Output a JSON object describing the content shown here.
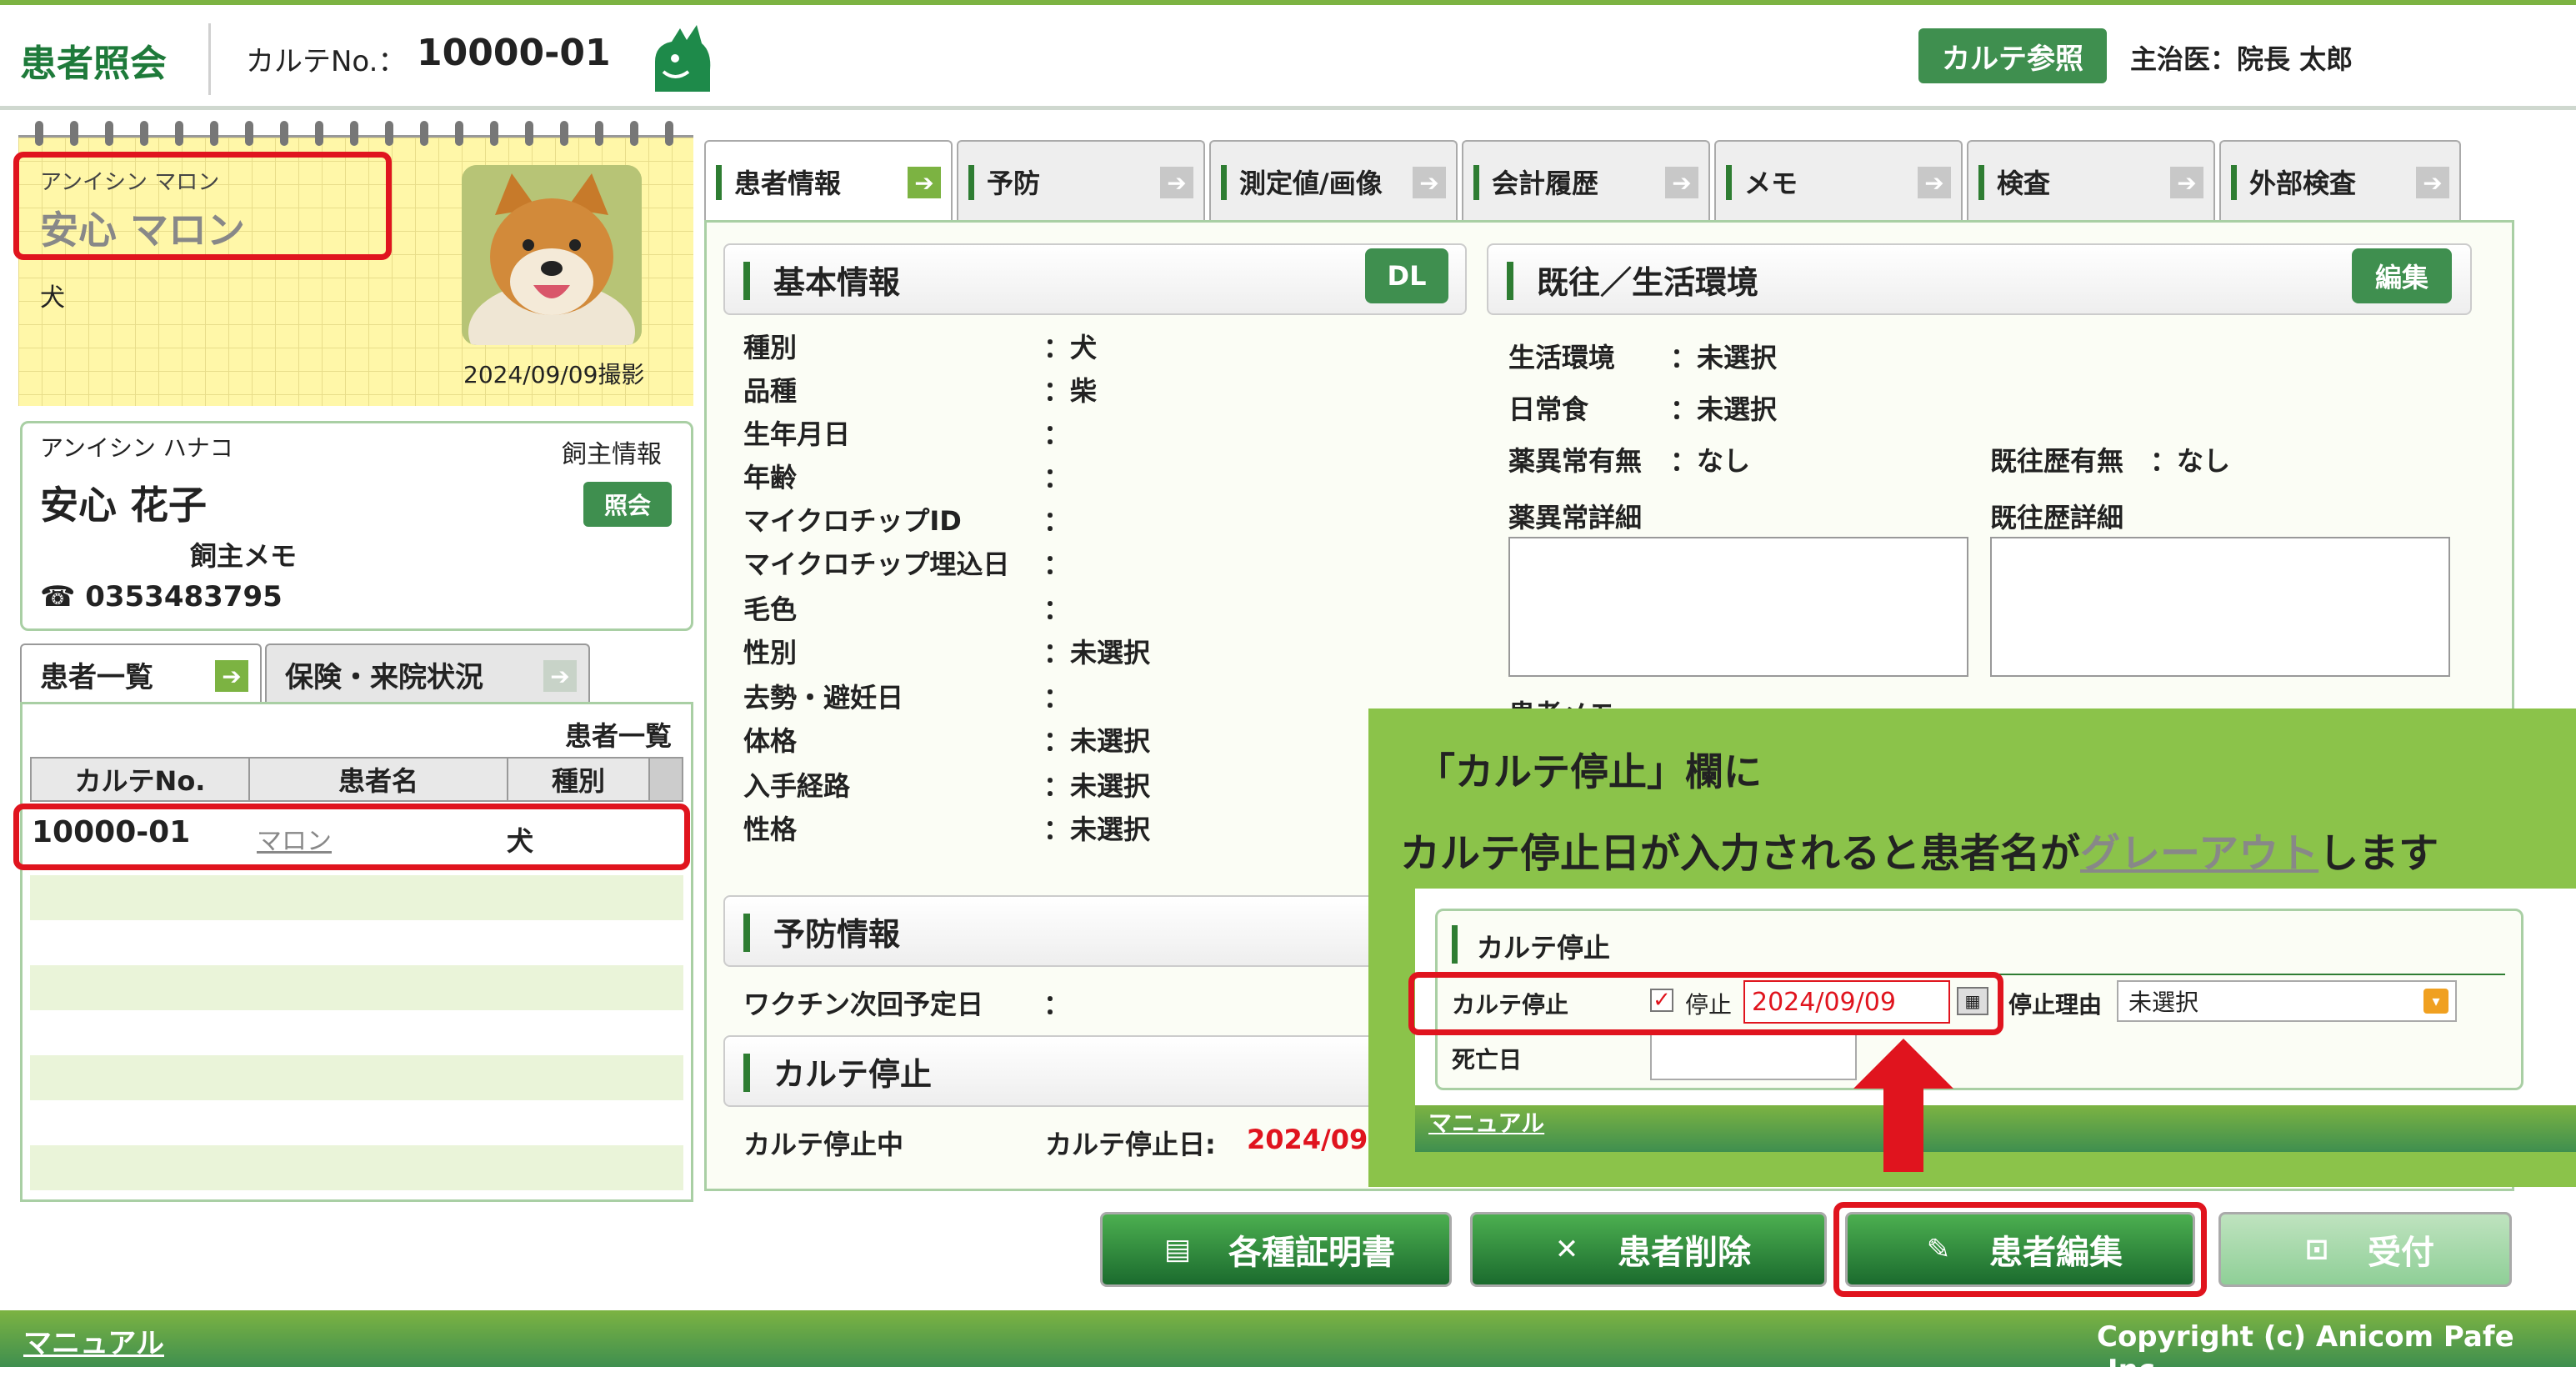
{
  "header": {
    "title": "患者照会",
    "karte_label": "カルテNo.：",
    "karte_no": "10000-01",
    "ref_button": "カルテ参照",
    "doctor": "主治医：院長 太郎"
  },
  "patient": {
    "kana": "アンイシン マロン",
    "name": "安心 マロン",
    "species": "犬",
    "photo_date": "2024/09/09撮影"
  },
  "owner": {
    "kana": "アンイシン ハナコ",
    "label": "飼主情報",
    "name": "安心 花子",
    "ref_button": "照会",
    "memo": "飼主メモ",
    "phone": "0353483795"
  },
  "left_tabs": [
    {
      "label": "患者一覧",
      "arrow": "➔"
    },
    {
      "label": "保険・来院状況",
      "arrow": "➔"
    }
  ],
  "patient_list": {
    "title": "患者一覧",
    "columns": [
      "カルテNo.",
      "患者名",
      "種別"
    ],
    "rows": [
      {
        "no": "10000-01",
        "name": "マロン",
        "species": "犬"
      }
    ]
  },
  "main_tabs": [
    {
      "label": "患者情報",
      "arrow": "➔"
    },
    {
      "label": "予防",
      "arrow": "➔"
    },
    {
      "label": "測定値/画像",
      "arrow": "➔"
    },
    {
      "label": "会計履歴",
      "arrow": "➔"
    },
    {
      "label": "メモ",
      "arrow": "➔"
    },
    {
      "label": "検査",
      "arrow": "➔"
    },
    {
      "label": "外部検査",
      "arrow": "➔"
    }
  ],
  "basic_info": {
    "title": "基本情報",
    "dl_button": "DL",
    "fields": [
      {
        "label": "種別",
        "value": "：犬"
      },
      {
        "label": "品種",
        "value": "：柴"
      },
      {
        "label": "生年月日",
        "value": "："
      },
      {
        "label": "年齢",
        "value": "："
      },
      {
        "label": "マイクロチップID",
        "value": "："
      },
      {
        "label": "マイクロチップ埋込日",
        "value": "："
      },
      {
        "label": "毛色",
        "value": "："
      },
      {
        "label": "性別",
        "value": "：未選択"
      },
      {
        "label": "去勢・避妊日",
        "value": "："
      },
      {
        "label": "体格",
        "value": "：未選択"
      },
      {
        "label": "入手経路",
        "value": "：未選択"
      },
      {
        "label": "性格",
        "value": "：未選択"
      }
    ]
  },
  "history": {
    "title": "既往／生活環境",
    "edit_button": "編集",
    "env_label": "生活環境",
    "env_value": "：未選択",
    "diet_label": "日常食",
    "diet_value": "：未選択",
    "drug_label": "薬異常有無",
    "drug_value": "：なし",
    "past_label": "既往歴有無",
    "past_value": "：なし",
    "drug_detail": "薬異常詳細",
    "past_detail": "既往歴詳細",
    "patient_memo": "患者メモ"
  },
  "prevention": {
    "title": "予防情報",
    "vaccine_label": "ワクチン次回予定日",
    "vaccine_value": "："
  },
  "karte_stop": {
    "title": "カルテ停止",
    "status": "カルテ停止中",
    "date_label": "カルテ停止日:",
    "date_value": "2024/09"
  },
  "callout": {
    "line1": "「カルテ停止」欄に",
    "line2_a": "カルテ停止日が入力されると患者名が",
    "line2_b": "グレーアウト",
    "line2_c": "します",
    "panel_title": "カルテ停止",
    "stop_label": "カルテ停止",
    "check_mark": "✓",
    "stop_check_label": "停止",
    "stop_date": "2024/09/09",
    "reason_label": "停止理由",
    "reason_value": "未選択",
    "death_label": "死亡日",
    "manual_link": "マニュアル"
  },
  "actions": {
    "certificate": "各種証明書",
    "delete": "患者削除",
    "edit": "患者編集",
    "reception": "受付"
  },
  "footer": {
    "manual": "マニュアル",
    "copyright": "Copyright (c) Anicom Pafe ,Inc."
  },
  "colors": {
    "brand_green": "#3f8f4f",
    "accent_green": "#7cb342",
    "highlight_red": "#e0141e"
  }
}
